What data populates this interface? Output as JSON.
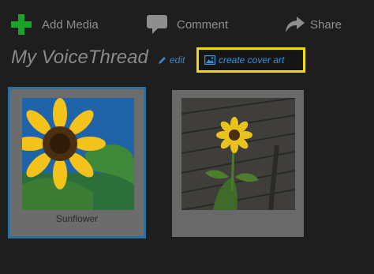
{
  "toolbar": {
    "add_media_label": "Add Media",
    "comment_label": "Comment",
    "share_label": "Share",
    "add_icon": "plus-icon",
    "comment_icon": "speech-bubble-icon",
    "share_icon": "share-arrow-icon",
    "add_icon_color": "#1aa32b"
  },
  "header": {
    "title": "My VoiceThread",
    "edit_label": "edit",
    "create_cover_label": "create cover art",
    "highlight_color": "#f2da0f",
    "link_color": "#3a84c4"
  },
  "slides": [
    {
      "caption": "Sunflower",
      "selected": true,
      "thumbnail": "sunflower-blue-sky"
    },
    {
      "caption": "",
      "selected": false,
      "thumbnail": "sunflower-dark-deck"
    }
  ]
}
